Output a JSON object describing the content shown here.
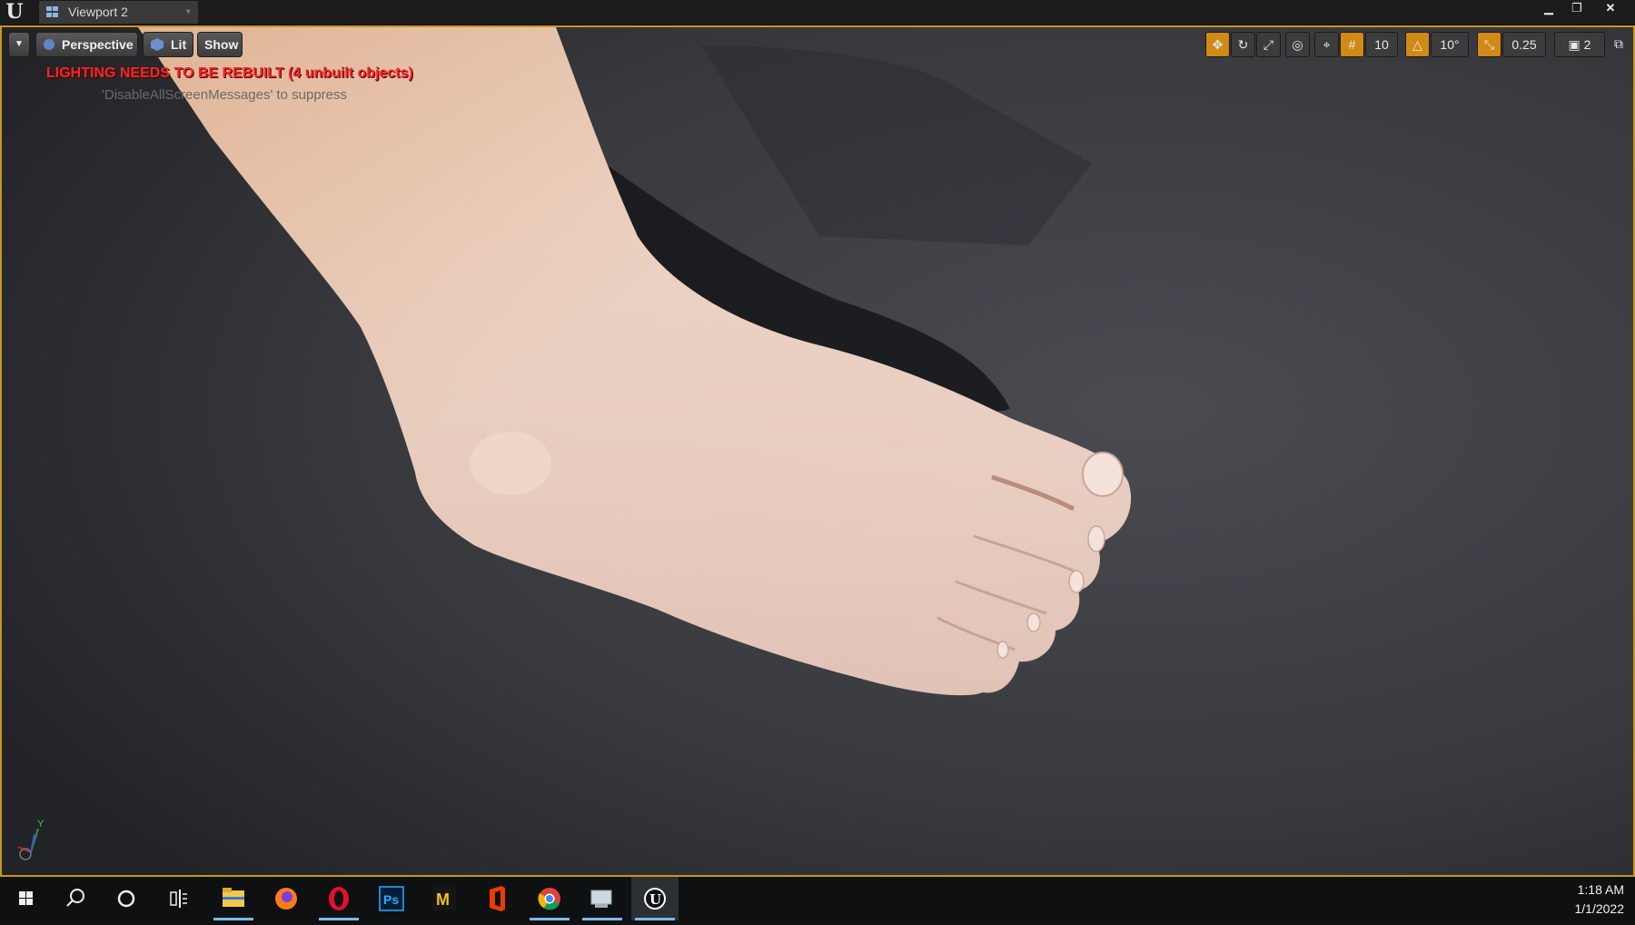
{
  "window": {
    "tab_title": "Viewport 2",
    "controls": {
      "minimize": "▁",
      "restore": "❐",
      "close": "✕"
    }
  },
  "viewport_toolbar": {
    "perspective_label": "Perspective",
    "lit_label": "Lit",
    "show_label": "Show"
  },
  "messages": {
    "warning": "LIGHTING NEEDS TO BE REBUILT (4 unbuilt objects)",
    "suppress_hint": "'DisableAllScreenMessages' to suppress"
  },
  "transform_toolbar": {
    "grid_snap_value": "10",
    "rotation_snap_value": "10°",
    "scale_snap_value": "0.25",
    "camera_speed_value": "2"
  },
  "gizmo": {
    "y_label": "Y"
  },
  "taskbar": {
    "apps": [
      {
        "name": "File Explorer",
        "icon": "folder-icon"
      },
      {
        "name": "Firefox",
        "icon": "firefox-icon"
      },
      {
        "name": "Opera",
        "icon": "opera-icon"
      },
      {
        "name": "Photoshop",
        "icon": "photoshop-icon",
        "text": "Ps"
      },
      {
        "name": "Marmoset",
        "icon": "marmoset-icon",
        "text": "M"
      },
      {
        "name": "Office",
        "icon": "office-icon"
      },
      {
        "name": "Chrome",
        "icon": "chrome-icon"
      },
      {
        "name": "Network",
        "icon": "network-icon"
      },
      {
        "name": "Unreal Engine",
        "icon": "unreal-icon"
      }
    ],
    "time": "1:18 AM",
    "date": "1/1/2022"
  },
  "colors": {
    "accent_active": "#d28a16",
    "viewport_border": "#c8961e",
    "warning_red": "#ff2424",
    "taskbar_underline": "#76b9ed"
  }
}
